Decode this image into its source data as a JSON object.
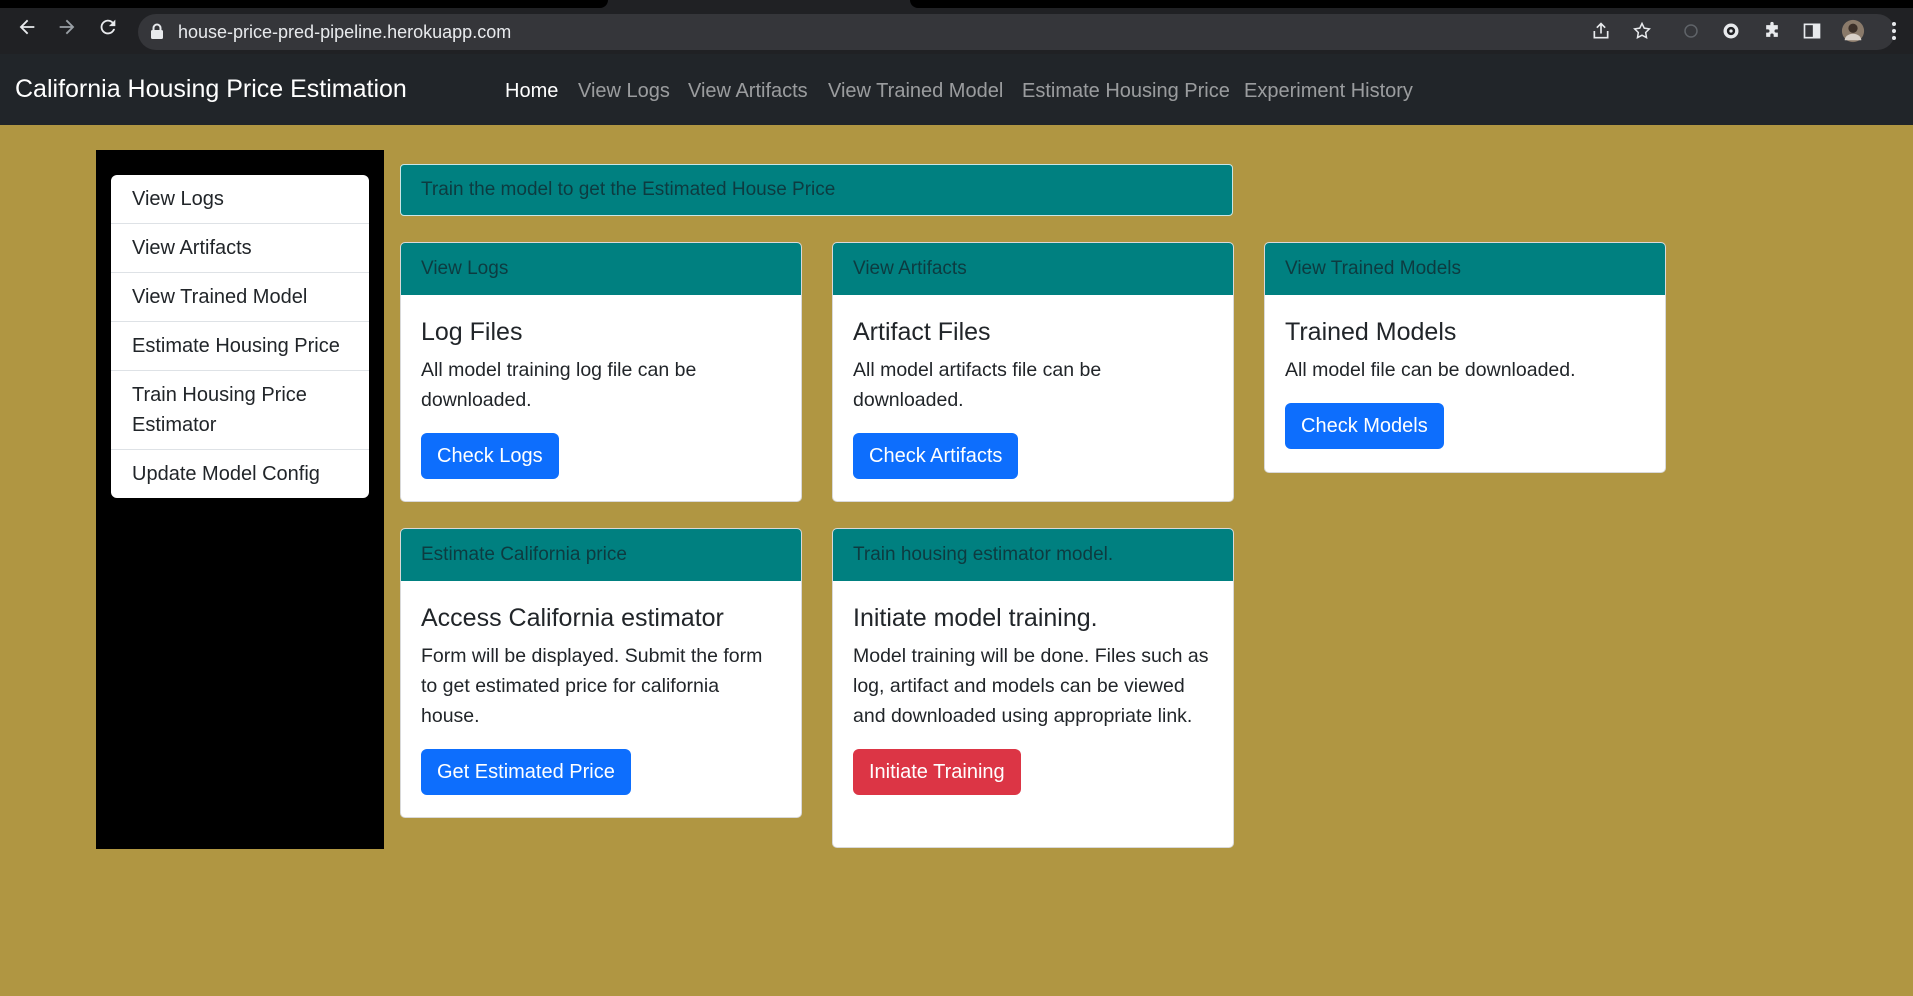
{
  "browser": {
    "url": "house-price-pred-pipeline.herokuapp.com"
  },
  "navbar": {
    "brand": "California Housing Price Estimation",
    "links": [
      {
        "label": "Home"
      },
      {
        "label": "View Logs"
      },
      {
        "label": "View Artifacts"
      },
      {
        "label": "View Trained Model"
      },
      {
        "label": "Estimate Housing Price"
      },
      {
        "label": "Experiment History"
      }
    ]
  },
  "sidebar": {
    "items": [
      {
        "label": "View Logs"
      },
      {
        "label": "View Artifacts"
      },
      {
        "label": "View Trained Model"
      },
      {
        "label": "Estimate Housing Price"
      },
      {
        "label": "Train Housing Price Estimator"
      },
      {
        "label": "Update Model Config"
      }
    ]
  },
  "alert": {
    "text": "Train the model to get the Estimated House Price"
  },
  "cards": [
    {
      "header": "View Logs",
      "title": "Log Files",
      "text": "All model training log file can be downloaded.",
      "button": "Check Logs"
    },
    {
      "header": "View Artifacts",
      "title": "Artifact Files",
      "text": "All model artifacts file can be downloaded.",
      "button": "Check Artifacts"
    },
    {
      "header": "View Trained Models",
      "title": "Trained Models",
      "text": "All model file can be downloaded.",
      "button": "Check Models"
    },
    {
      "header": "Estimate California price",
      "title": "Access California estimator",
      "text": "Form will be displayed. Submit the form to get estimated price for california house.",
      "button": "Get Estimated Price"
    },
    {
      "header": "Train housing estimator model.",
      "title": "Initiate model training.",
      "text": "Model training will be done. Files such as log, artifact and models can be viewed and downloaded using appropriate link.",
      "button": "Initiate Training"
    }
  ],
  "colors": {
    "page_background": "#b09642",
    "navbar": "#212529",
    "card_header": "#008080",
    "primary_button": "#0d6efd",
    "danger_button": "#dc3545"
  }
}
